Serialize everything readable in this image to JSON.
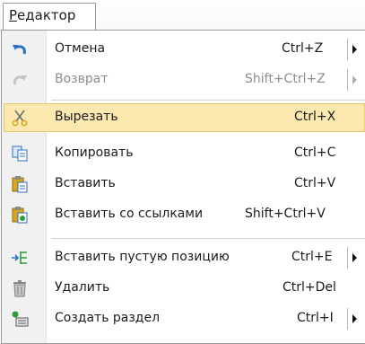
{
  "menubar": {
    "title_accel": "Р",
    "title_rest": "едактор"
  },
  "menu": {
    "undo": {
      "label": "Отмена",
      "shortcut": "Ctrl+Z",
      "icon": "undo-arrow-icon",
      "disabled": false
    },
    "redo": {
      "label": "Возврат",
      "shortcut": "Shift+Ctrl+Z",
      "icon": "redo-arrow-icon",
      "disabled": true
    },
    "cut": {
      "label": "Вырезать",
      "shortcut": "Ctrl+X",
      "icon": "scissors-icon",
      "highlighted": true
    },
    "copy": {
      "label": "Копировать",
      "shortcut": "Ctrl+C",
      "icon": "copy-pages-icon"
    },
    "paste": {
      "label": "Вставить",
      "shortcut": "Ctrl+V",
      "icon": "clipboard-paste-icon"
    },
    "paste_links": {
      "label": "Вставить со ссылками",
      "shortcut": "Shift+Ctrl+V",
      "icon": "clipboard-link-icon"
    },
    "insert_empty": {
      "label": "Вставить пустую позицию",
      "shortcut": "Ctrl+E",
      "icon": "insert-row-icon"
    },
    "delete": {
      "label": "Удалить",
      "shortcut": "Ctrl+Del",
      "icon": "trash-icon"
    },
    "section": {
      "label": "Создать раздел",
      "shortcut": "Ctrl+I",
      "icon": "create-section-icon"
    }
  },
  "colors": {
    "highlight_fill": "#fde8b0",
    "highlight_border": "#e9c66a",
    "gutter": "#f1f1f1",
    "icon_blue": "#2f6fc1",
    "icon_gold": "#d9a520",
    "icon_green": "#2e9e3a"
  }
}
